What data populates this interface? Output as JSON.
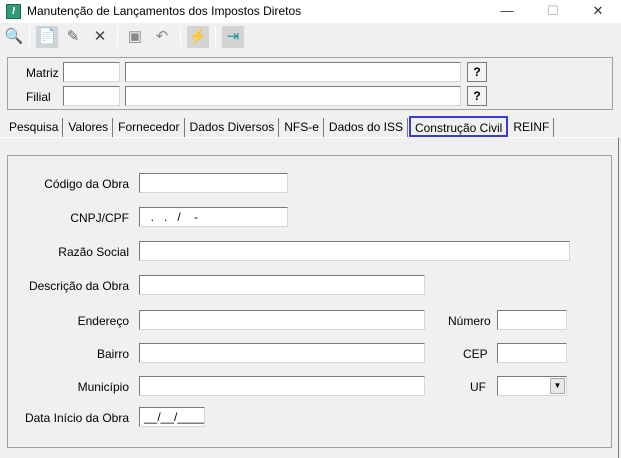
{
  "window": {
    "title": "Manutenção de Lançamentos dos Impostos Diretos",
    "icon_letter": "I",
    "minimize": "—",
    "maximize": "☐",
    "close": "✕"
  },
  "toolbar": {
    "icons": [
      "binoculars-icon",
      "new-document-icon",
      "edit-icon",
      "delete-icon",
      "save-icon",
      "undo-icon",
      "filter-icon",
      "exit-icon"
    ]
  },
  "header": {
    "matriz_label": "Matriz",
    "filial_label": "Filial",
    "matriz_code": "",
    "matriz_name": "",
    "filial_code": "",
    "filial_name": "",
    "help": "?"
  },
  "tabs": [
    {
      "label": "Pesquisa"
    },
    {
      "label": "Valores"
    },
    {
      "label": "Fornecedor"
    },
    {
      "label": "Dados Diversos"
    },
    {
      "label": "NFS-e"
    },
    {
      "label": "Dados do ISS"
    },
    {
      "label": "Construção Civil",
      "active": true
    },
    {
      "label": "REINF"
    }
  ],
  "form": {
    "codigo_obra": {
      "label": "Código da Obra",
      "value": ""
    },
    "cnpj_cpf": {
      "label": "CNPJ/CPF",
      "value": "  .   .   /    -"
    },
    "razao_social": {
      "label": "Razão Social",
      "value": ""
    },
    "descricao_obra": {
      "label": "Descrição da Obra",
      "value": ""
    },
    "endereco": {
      "label": "Endereço",
      "value": ""
    },
    "numero": {
      "label": "Número",
      "value": ""
    },
    "bairro": {
      "label": "Bairro",
      "value": ""
    },
    "cep": {
      "label": "CEP",
      "value": ""
    },
    "municipio": {
      "label": "Município",
      "value": ""
    },
    "uf": {
      "label": "UF",
      "value": ""
    },
    "data_inicio": {
      "label": "Data Início da Obra",
      "value": "__/__/____"
    }
  }
}
